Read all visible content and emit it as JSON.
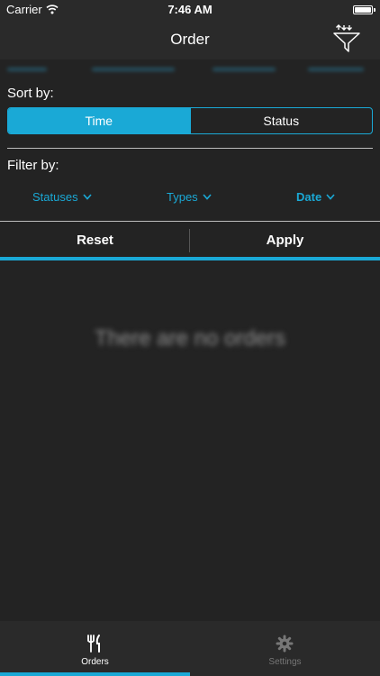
{
  "status_bar": {
    "carrier": "Carrier",
    "time": "7:46 AM"
  },
  "nav": {
    "title": "Order",
    "filter_icon": "funnel-sort-icon"
  },
  "sort": {
    "label": "Sort by:",
    "options": [
      "Time",
      "Status"
    ],
    "selected": "Time"
  },
  "filter": {
    "label": "Filter by:",
    "items": [
      {
        "label": "Statuses"
      },
      {
        "label": "Types"
      },
      {
        "label": "Date"
      }
    ]
  },
  "actions": {
    "reset": "Reset",
    "apply": "Apply"
  },
  "content": {
    "empty_message": "There are no orders"
  },
  "tabs": [
    {
      "label": "Orders",
      "icon": "fork-knife-icon",
      "active": true
    },
    {
      "label": "Settings",
      "icon": "gear-icon",
      "active": false
    }
  ],
  "colors": {
    "accent": "#1aa9d6",
    "background": "#232323",
    "bar": "#2a2a2a"
  }
}
